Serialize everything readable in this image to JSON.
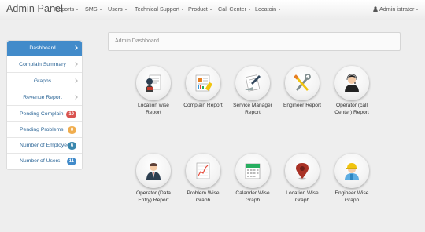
{
  "navbar": {
    "brand": "Admin Panel",
    "menus": [
      "Reports",
      "SMS",
      "Users",
      "Technical Support",
      "Product",
      "Call Center",
      "Locatoin"
    ],
    "user": "Admin istrator"
  },
  "sidebar": {
    "items": [
      {
        "label": "Dashboard",
        "active": true
      },
      {
        "label": "Complain Summary"
      },
      {
        "label": "Graphs"
      },
      {
        "label": "Revenue Report"
      },
      {
        "label": "Pending Complain",
        "badge": "10",
        "badge_color": "#d9534f"
      },
      {
        "label": "Pending Problems",
        "badge": "0",
        "badge_color": "#f0ad4e"
      },
      {
        "label": "Number of Employees",
        "badge": "6",
        "badge_color": "#3a87ad"
      },
      {
        "label": "Number of Users",
        "badge": "11",
        "badge_color": "#428bca"
      }
    ]
  },
  "main": {
    "title": "Admin Dashboard",
    "tiles": [
      {
        "icon": "location-report-icon",
        "line1": "Location wise",
        "line2": "Report"
      },
      {
        "icon": "complain-report-icon",
        "line1": "Complain Report",
        "line2": ""
      },
      {
        "icon": "service-manager-icon",
        "line1": "Service Manager",
        "line2": "Report"
      },
      {
        "icon": "engineer-report-icon",
        "line1": "Engineer Report",
        "line2": ""
      },
      {
        "icon": "operator-call-center-icon",
        "line1": "Operator (call",
        "line2": "Center) Report"
      },
      {
        "icon": "operator-data-entry-icon",
        "line1": "Operator (Data",
        "line2": "Entry) Report"
      },
      {
        "icon": "problem-graph-icon",
        "line1": "Problem Wise",
        "line2": "Graph"
      },
      {
        "icon": "calendar-graph-icon",
        "line1": "Calander Wise",
        "line2": "Graph"
      },
      {
        "icon": "location-graph-icon",
        "line1": "Location Wise",
        "line2": "Graph"
      },
      {
        "icon": "engineer-graph-icon",
        "line1": "Engineer Wise",
        "line2": "Graph"
      }
    ]
  }
}
